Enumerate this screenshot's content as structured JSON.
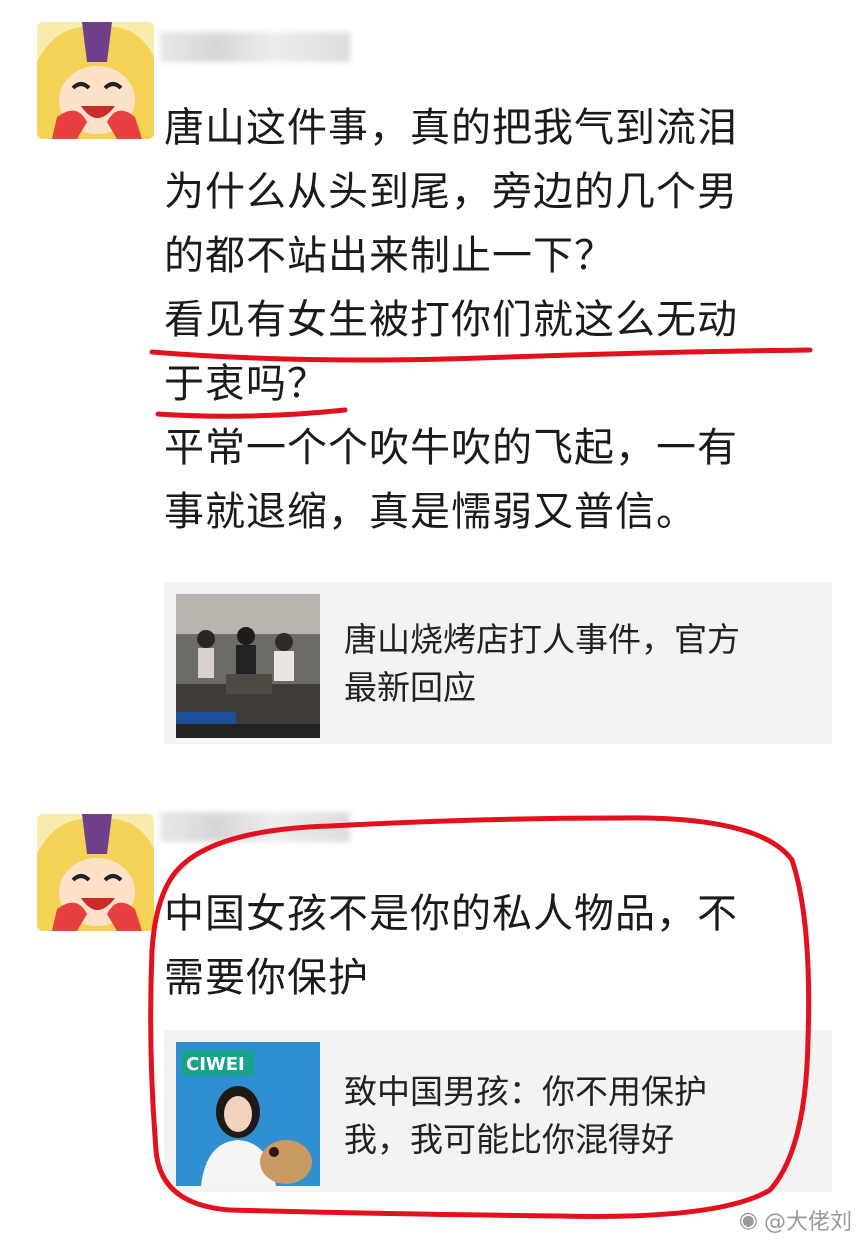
{
  "posts": [
    {
      "nickname": "",
      "text": "唐山这件事，真的把我气到流泪\n为什么从头到尾，旁边的几个男\n的都不站出来制止一下？\n看见有女生被打你们就这么无动\n于衷吗？\n平常一个个吹牛吹的飞起，一有\n事就退缩，真是懦弱又普信。",
      "link": {
        "title": "唐山烧烤店打人事件，官方\n最新回应"
      }
    },
    {
      "nickname": "",
      "text": "中国女孩不是你的私人物品，不\n需要你保护",
      "link": {
        "thumb_text": "CIWEI",
        "title": "致中国男孩：你不用保护\n我，我可能比你混得好"
      }
    }
  ],
  "colors": {
    "annotation_red": "#e3101d",
    "card_bg": "#f3f3f3",
    "watermark": "#9a9a9a"
  },
  "watermark": {
    "icon": "weibo-icon",
    "text": "@大佬刘"
  }
}
